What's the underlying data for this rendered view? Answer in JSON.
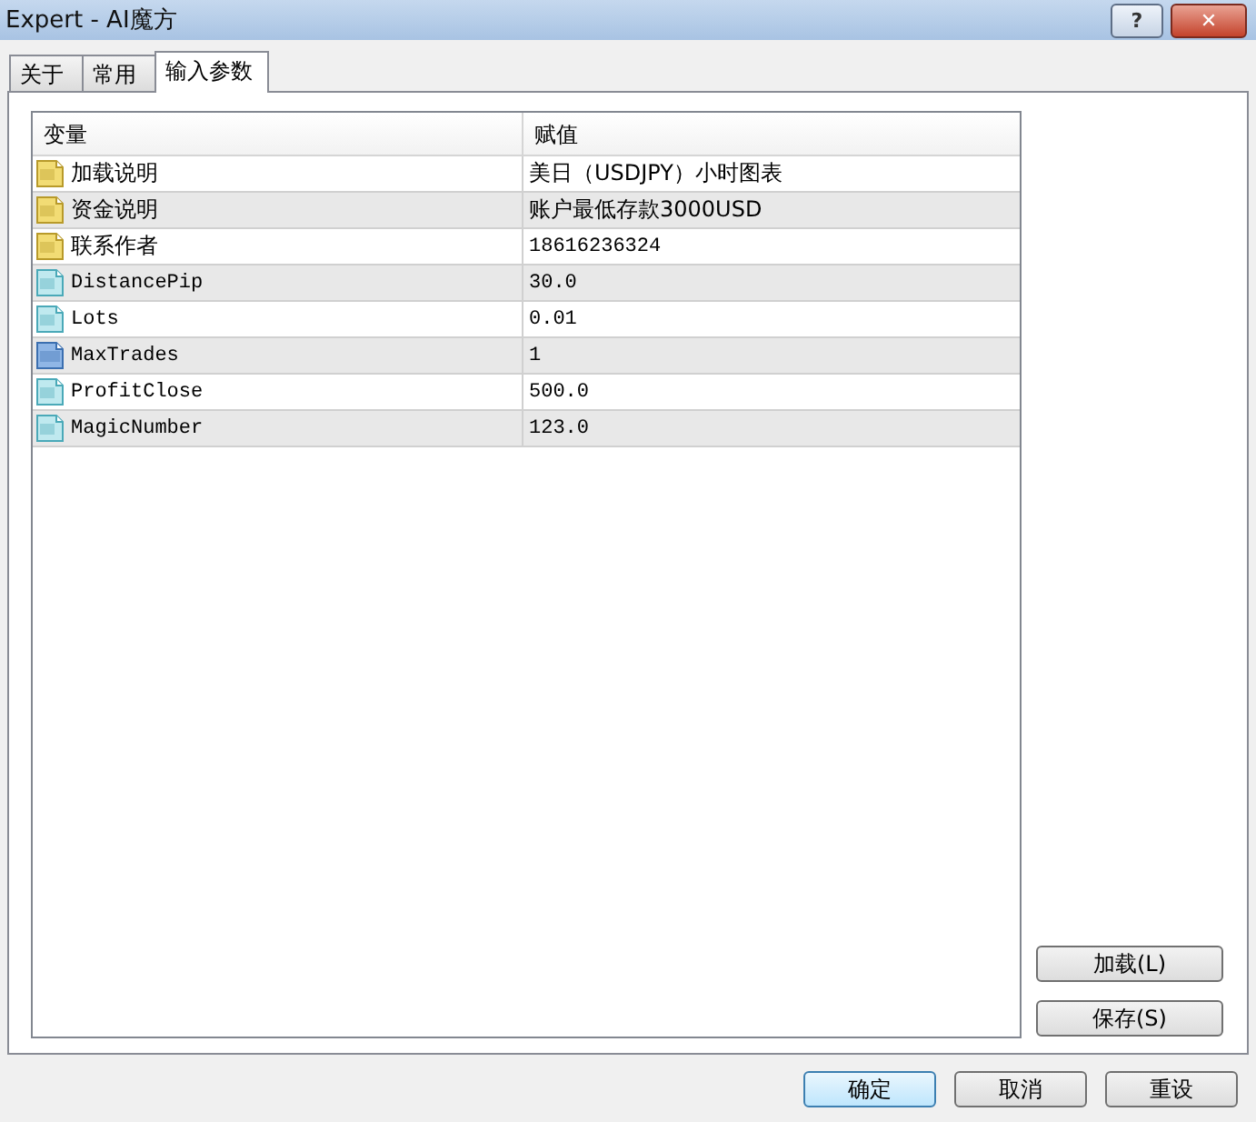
{
  "window": {
    "title": "Expert - AI魔方",
    "help_button": "?",
    "close_button": "✕"
  },
  "tabs": [
    {
      "label": "关于",
      "selected": false
    },
    {
      "label": "常用",
      "selected": false
    },
    {
      "label": "输入参数",
      "selected": true
    }
  ],
  "table": {
    "columns": [
      "变量",
      "赋值"
    ],
    "rows": [
      {
        "kind": "string",
        "name": "加载说明",
        "value": "美日（USDJPY）小时图表"
      },
      {
        "kind": "string",
        "name": "资金说明",
        "value": "账户最低存款3000USD"
      },
      {
        "kind": "string",
        "name": "联系作者",
        "value": "18616236324"
      },
      {
        "kind": "double",
        "name": "DistancePip",
        "value": "30.0"
      },
      {
        "kind": "double",
        "name": "Lots",
        "value": "0.01"
      },
      {
        "kind": "int",
        "name": "MaxTrades",
        "value": "1"
      },
      {
        "kind": "double",
        "name": "ProfitClose",
        "value": "500.0"
      },
      {
        "kind": "double",
        "name": "MagicNumber",
        "value": "123.0"
      }
    ]
  },
  "side_buttons": [
    "加载(L)",
    "保存(S)"
  ],
  "bottom_buttons": [
    {
      "label": "确定",
      "default": true
    },
    {
      "label": "取消",
      "default": false
    },
    {
      "label": "重设",
      "default": false
    }
  ]
}
